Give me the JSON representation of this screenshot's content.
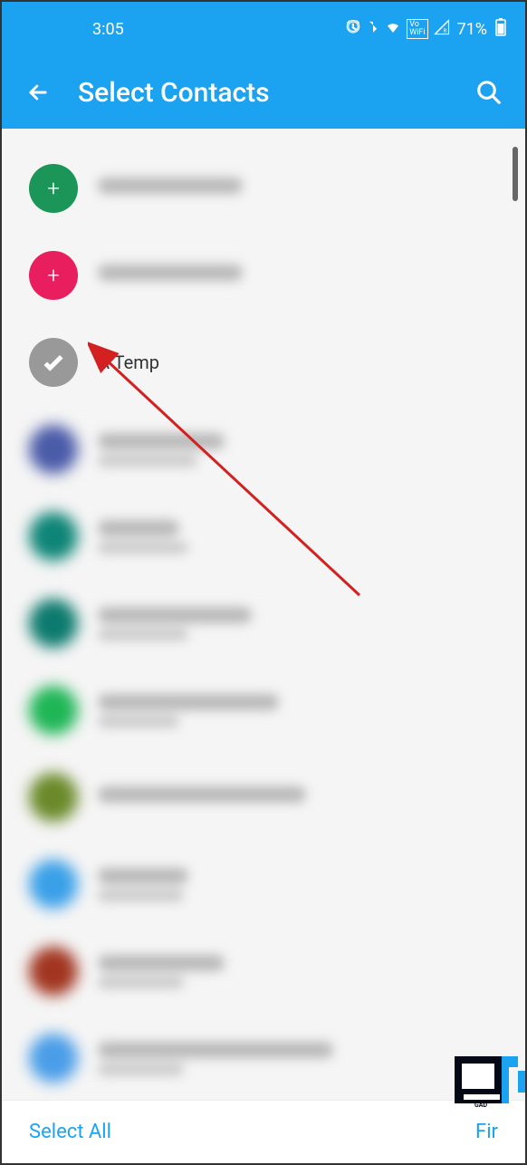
{
  "status": {
    "time": "3:05",
    "battery": "71%"
  },
  "header": {
    "title": "Select Contacts"
  },
  "contacts": {
    "selected": {
      "name": "A Temp"
    }
  },
  "bottom": {
    "selectAll": "Select All",
    "right": "Fir"
  }
}
